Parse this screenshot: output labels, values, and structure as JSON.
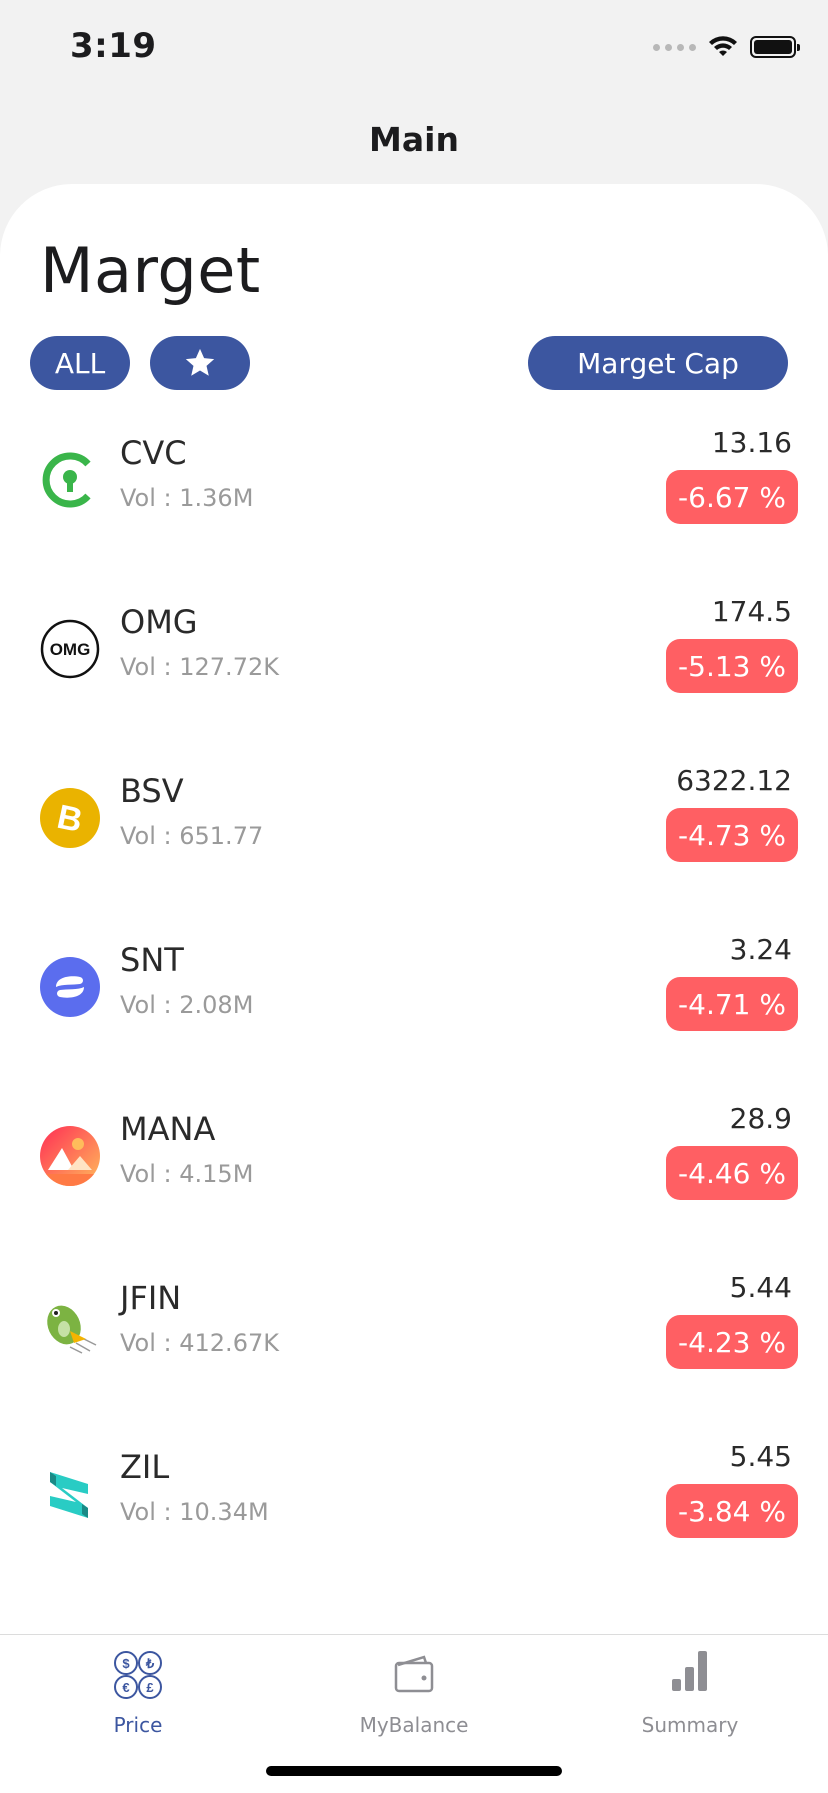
{
  "status_bar": {
    "time": "3:19"
  },
  "nav": {
    "title": "Main"
  },
  "page": {
    "title": "Marget"
  },
  "filters": {
    "all_label": "ALL",
    "star_icon": "star-icon",
    "cap_label": "Marget Cap"
  },
  "colors": {
    "accent": "#3c56a0",
    "negative": "#ff5f63"
  },
  "coins": [
    {
      "symbol": "CVC",
      "vol": "Vol : 1.36M",
      "price": "13.16",
      "change": "-6.67 %",
      "icon": "cvc-logo"
    },
    {
      "symbol": "OMG",
      "vol": "Vol : 127.72K",
      "price": "174.5",
      "change": "-5.13 %",
      "icon": "omg-logo"
    },
    {
      "symbol": "BSV",
      "vol": "Vol : 651.77",
      "price": "6322.12",
      "change": "-4.73 %",
      "icon": "bsv-logo"
    },
    {
      "symbol": "SNT",
      "vol": "Vol : 2.08M",
      "price": "3.24",
      "change": "-4.71 %",
      "icon": "snt-logo"
    },
    {
      "symbol": "MANA",
      "vol": "Vol : 4.15M",
      "price": "28.9",
      "change": "-4.46 %",
      "icon": "mana-logo"
    },
    {
      "symbol": "JFIN",
      "vol": "Vol : 412.67K",
      "price": "5.44",
      "change": "-4.23 %",
      "icon": "jfin-logo"
    },
    {
      "symbol": "ZIL",
      "vol": "Vol : 10.34M",
      "price": "5.45",
      "change": "-3.84 %",
      "icon": "zil-logo"
    }
  ],
  "tabs": [
    {
      "label": "Price",
      "icon": "currency-exchange-icon",
      "active": true
    },
    {
      "label": "MyBalance",
      "icon": "wallet-icon",
      "active": false
    },
    {
      "label": "Summary",
      "icon": "bar-chart-icon",
      "active": false
    }
  ]
}
